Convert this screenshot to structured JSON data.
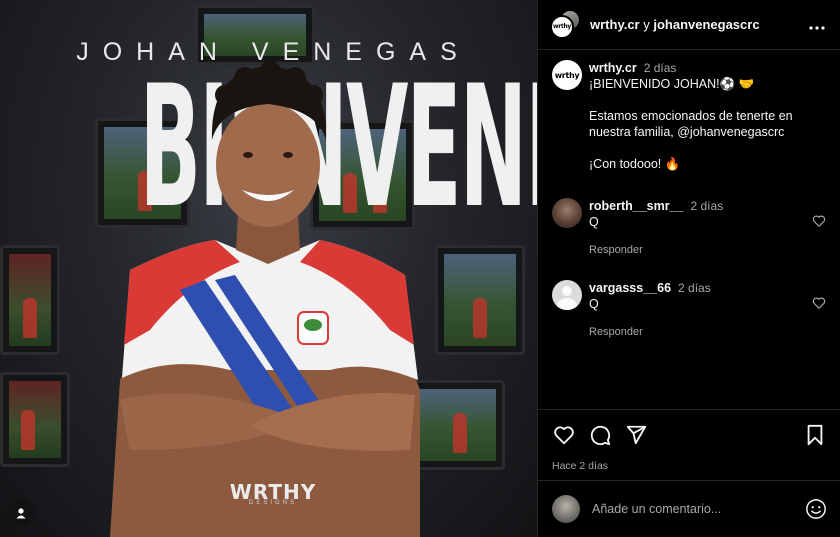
{
  "post_image": {
    "overline": "JOHAN VENEGAS",
    "headline": "BIENVENIDO",
    "watermark": "WRTHY",
    "watermark_sub": "DESIGNS"
  },
  "header": {
    "account_a": "wrthy.cr",
    "separator": " y ",
    "account_b": "johanvenegascrc",
    "logo_text": "wrthy"
  },
  "caption": {
    "username": "wrthy.cr",
    "time": "2 días",
    "line1": "¡BIENVENIDO JOHAN!⚽️ 🤝",
    "line2": "Estamos emocionados de tenerte en nuestra familia, @johanvenegascrc",
    "line3": "¡Con todooo! 🔥"
  },
  "comments": [
    {
      "username": "roberth__smr__",
      "time": "2 días",
      "text": "Q",
      "reply": "Responder"
    },
    {
      "username": "vargasss__66",
      "time": "2 días",
      "text": "Q",
      "reply": "Responder"
    }
  ],
  "actions": {
    "posted": "Hace 2 días"
  },
  "add_comment": {
    "placeholder": "Añade un comentario..."
  },
  "colors": {
    "jersey_red": "#d93a36",
    "jersey_blue": "#2f4fb0",
    "panel_bg": "#000000",
    "muted": "#a8a8a8"
  }
}
